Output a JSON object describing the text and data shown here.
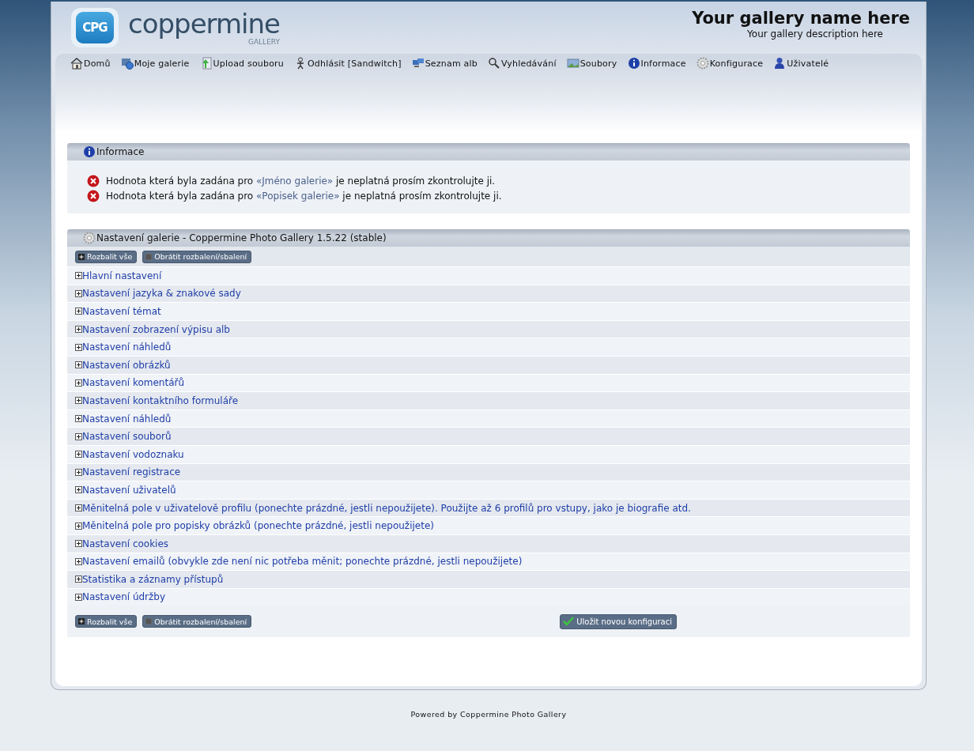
{
  "header": {
    "logo_text": "coppermine",
    "logo_sub": "GALLERY",
    "logo_badge": "CPG",
    "gallery_name": "Your gallery name here",
    "gallery_description": "Your gallery description here"
  },
  "nav": [
    {
      "label": "Domů"
    },
    {
      "label": "Moje galerie"
    },
    {
      "label": "Upload souboru"
    },
    {
      "label": "Odhlásit [Sandwitch]"
    },
    {
      "label": "Seznam alb"
    },
    {
      "label": "Vyhledávání"
    },
    {
      "label": "Soubory"
    },
    {
      "label": "Informace"
    },
    {
      "label": "Konfigurace"
    },
    {
      "label": "Uživatelé"
    }
  ],
  "info_panel": {
    "title": "Informace",
    "messages": [
      {
        "before": "Hodnota která byla zadána pro ",
        "link": "«Jméno galerie»",
        "after": " je neplatná prosím zkontrolujte ji."
      },
      {
        "before": "Hodnota která byla zadána pro ",
        "link": "«Popisek galerie»",
        "after": " je neplatná prosím zkontrolujte ji."
      }
    ]
  },
  "config_panel": {
    "title": "Nastavení galerie - Coppermine Photo Gallery 1.5.22 (stable)",
    "top_buttons": [
      "Rozbalit vše",
      "Obrátit rozbalení/sbalení"
    ],
    "sections": [
      {
        "label": "Hlavní nastavení",
        "expanded": false
      },
      {
        "label": "Nastavení jazyka & znakové sady",
        "expanded": false
      },
      {
        "label": "Nastavení témat",
        "expanded": false
      },
      {
        "label": "Nastavení zobrazení výpisu alb",
        "expanded": false
      },
      {
        "label": "Nastavení náhledů",
        "expanded": false
      },
      {
        "label": "Nastavení obrázků",
        "expanded": false
      },
      {
        "label": "Nastavení komentářů",
        "expanded": false
      },
      {
        "label": "Nastavení kontaktního formuláře",
        "expanded": false
      },
      {
        "label": "Nastavení náhledů",
        "expanded": false
      },
      {
        "label": "Nastavení souborů",
        "expanded": false
      },
      {
        "label": "Nastavení vodoznaku",
        "expanded": false
      },
      {
        "label": "Nastavení registrace",
        "expanded": false
      },
      {
        "label": "Nastavení uživatelů",
        "expanded": false
      },
      {
        "label": "Měnitelná pole v uživatelově profilu (ponechte prázdné, jestli nepoužijete). Použijte až 6 profilů pro vstupy, jako je biografie atd.",
        "expanded": false
      },
      {
        "label": "Měnitelná pole pro popisky obrázků (ponechte prázdné, jestli nepoužijete)",
        "expanded": false
      },
      {
        "label": "Nastavení cookies",
        "expanded": false
      },
      {
        "label": "Nastavení emailů (obvykle zde není nic potřeba měnit; ponechte prázdné, jestli nepoužijete)",
        "expanded": false
      },
      {
        "label": "Statistika a záznamy přístupů",
        "expanded": false
      },
      {
        "label": "Nastavení údržby",
        "expanded": false
      }
    ],
    "bottom_buttons": [
      "Rozbalit vše",
      "Obrátit rozbalení/sbalení"
    ],
    "save_button": "Uložit novou konfiguraci"
  },
  "footer": "Powered by Coppermine Photo Gallery"
}
